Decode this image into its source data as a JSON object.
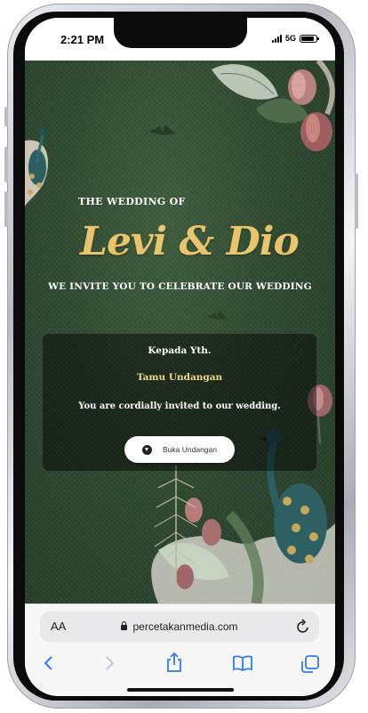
{
  "status_bar": {
    "time": "2:21 PM",
    "network": "5G"
  },
  "invitation": {
    "pre_title": "THE WEDDING OF",
    "couple_names": "Levi & Dio",
    "subtitle": "WE INVITE YOU TO CELEBRATE OUR WEDDING",
    "card": {
      "recipient_label": "Kepada Yth.",
      "guest_name": "Tamu Undangan",
      "message": "You are cordially invited to our wedding.",
      "open_button_label": "Buka Undangan"
    }
  },
  "browser": {
    "text_size_label": "AA",
    "url": "percetakanmedia.com"
  },
  "colors": {
    "background_green": "#2f4a30",
    "gold": "#e8c46c",
    "guest_gold": "#f2d98a"
  }
}
